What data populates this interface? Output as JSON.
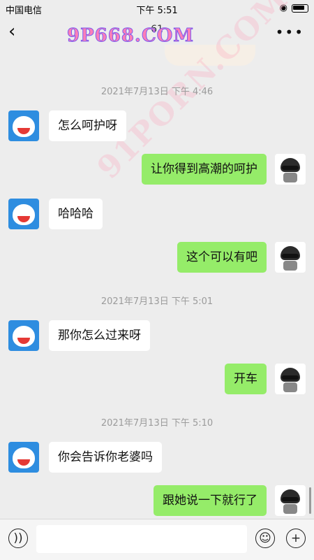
{
  "status": {
    "carrier": "中国电信",
    "time": "下午 5:51"
  },
  "header": {
    "title": "61",
    "watermark": "9P668.COM",
    "watermark2": "91PORN.COM"
  },
  "messages": [
    {
      "type": "timestamp",
      "text": "2021年7月13日 下午 4:46"
    },
    {
      "type": "left",
      "text": "怎么呵护呀"
    },
    {
      "type": "right",
      "text": "让你得到高潮的呵护"
    },
    {
      "type": "left",
      "text": "哈哈哈"
    },
    {
      "type": "right",
      "text": "这个可以有吧"
    },
    {
      "type": "timestamp",
      "text": "2021年7月13日 下午 5:01"
    },
    {
      "type": "left",
      "text": "那你怎么过来呀"
    },
    {
      "type": "right",
      "text": "开车"
    },
    {
      "type": "timestamp",
      "text": "2021年7月13日 下午 5:10"
    },
    {
      "type": "left",
      "text": "你会告诉你老婆吗"
    },
    {
      "type": "right",
      "text": "跟她说一下就行了"
    }
  ],
  "input": {
    "value": "",
    "placeholder": ""
  },
  "icons": {
    "voice": "voice-icon",
    "emoji": "emoji-icon",
    "plus": "plus-icon"
  }
}
